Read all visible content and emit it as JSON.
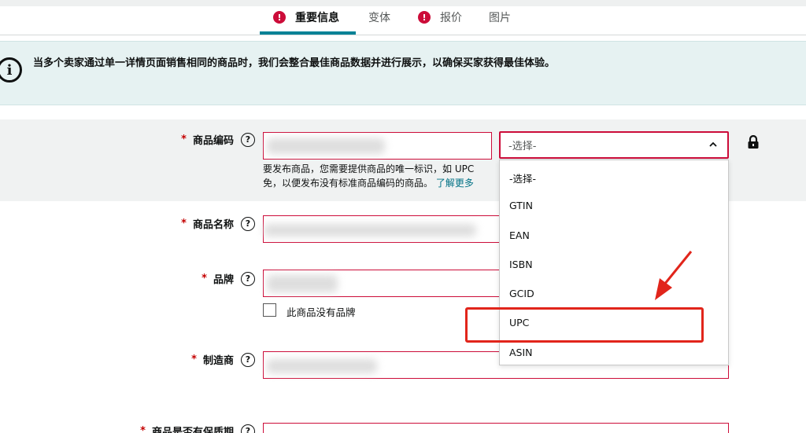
{
  "tabs": [
    {
      "label": "重要信息",
      "alert": "!"
    },
    {
      "label": "变体"
    },
    {
      "label": "报价",
      "alert": "!"
    },
    {
      "label": "图片"
    }
  ],
  "banner": {
    "icon": "info-icon",
    "glyph": "i",
    "text": "当多个卖家通过单一详情页面销售相同的商品时，我们会整合最佳商品数据并进行展示，以确保买家获得最佳体验。"
  },
  "form": {
    "required_mark": "*",
    "help_glyph": "?",
    "product_id": {
      "label": "商品编码",
      "hint_line1": "要发布商品，您需要提供商品的唯一标识，如 UPC",
      "hint_line2": "免，以便发布没有标准商品编码的商品。",
      "learn_more": "了解更多",
      "select_value": "-选择-",
      "options": [
        "-选择-",
        "GTIN",
        "EAN",
        "ISBN",
        "GCID",
        "UPC",
        "ASIN"
      ]
    },
    "product_name": {
      "label": "商品名称"
    },
    "brand": {
      "label": "品牌",
      "no_brand_label": "此商品没有品牌"
    },
    "manufacturer": {
      "label": "制造商"
    },
    "warranty": {
      "label": "商品是否有保质期"
    }
  },
  "colors": {
    "accent": "#008296",
    "error": "#cc0c39",
    "annotation": "#e1251b",
    "link": "#007185"
  }
}
